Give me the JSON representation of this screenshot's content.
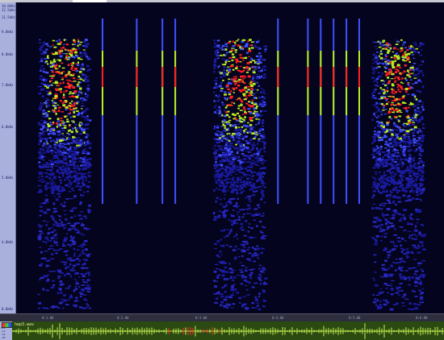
{
  "app": {
    "file_label": "hep3.wav"
  },
  "freq_axis": {
    "labels": [
      "10.0kHz",
      "12.5kHz",
      "11.5kHz",
      "9.0kHz",
      "8.0kHz",
      "7.0kHz",
      "6.0kHz",
      "5.0kHz",
      "4.0kHz",
      "0.0kHz"
    ]
  },
  "time_axis": {
    "labels": [
      "0:1.00",
      "0:2.00",
      "0:3.00",
      "0:4.00",
      "0:5.00",
      "0:6.00"
    ]
  },
  "waveform": {
    "scale_labels": [
      "6dB",
      "-12",
      "-24",
      "-48"
    ]
  },
  "colors": {
    "background": "#04041e",
    "low": "#1a1aa0",
    "mid": "#4050ff",
    "high": "#b8f020",
    "peak": "#ff2020",
    "waveform": "#c8f050",
    "waveform_clip": "#ff3030"
  },
  "spectrogram": {
    "bursts": [
      {
        "start": 0.05,
        "end": 0.17,
        "strength": 1.0
      },
      {
        "start": 0.46,
        "end": 0.58,
        "strength": 1.0
      },
      {
        "start": 0.83,
        "end": 0.95,
        "strength": 1.0
      }
    ],
    "clicks": [
      0.2,
      0.28,
      0.34,
      0.37,
      0.61,
      0.68,
      0.71,
      0.74,
      0.77,
      0.8
    ]
  }
}
